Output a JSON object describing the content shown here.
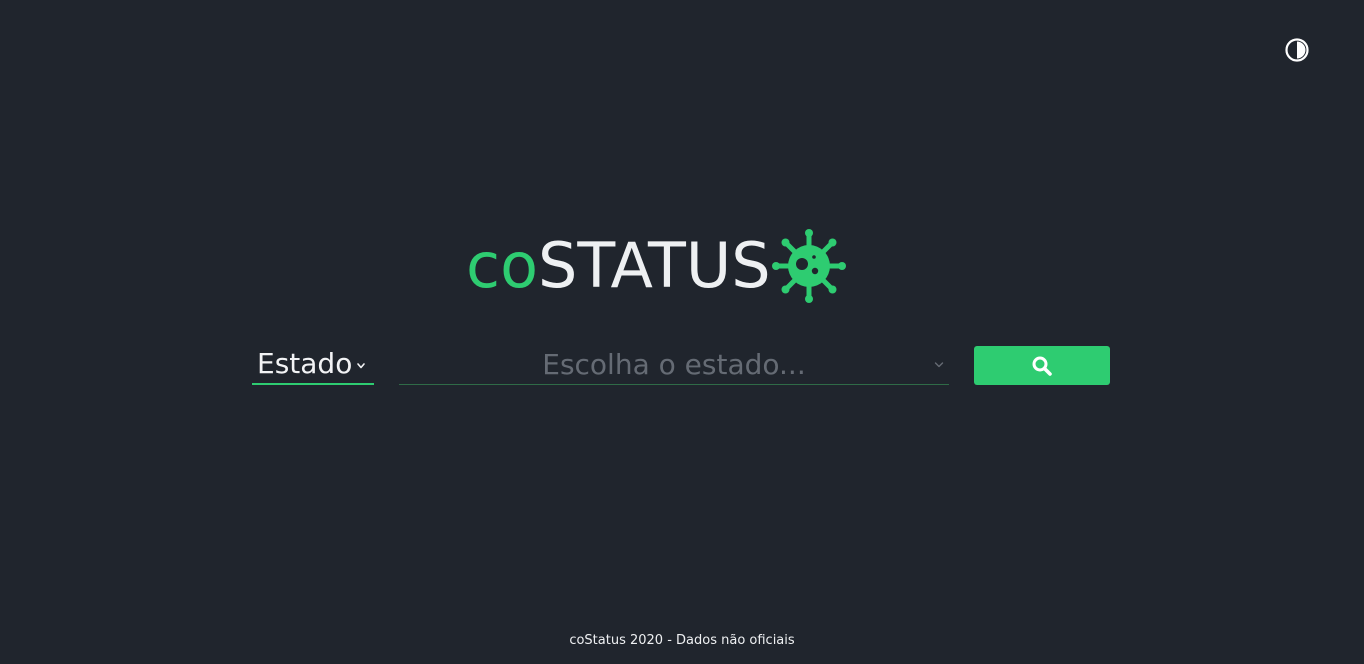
{
  "header": {
    "theme_toggle_icon": "contrast-icon"
  },
  "logo": {
    "prefix": "co",
    "main": "STATUS",
    "icon": "virus-icon",
    "accent_color": "#2ecc71"
  },
  "search": {
    "scope_label": "Estado",
    "scope_icon": "chevron-down-icon",
    "placeholder": "Escolha o estado...",
    "combo_icon": "chevron-down-icon",
    "button_icon": "search-icon"
  },
  "footer": {
    "text": "coStatus 2020 - Dados não oficiais"
  },
  "colors": {
    "background": "#20252d",
    "accent": "#2ecc71",
    "text": "#eef0f2",
    "placeholder": "#656b74"
  }
}
